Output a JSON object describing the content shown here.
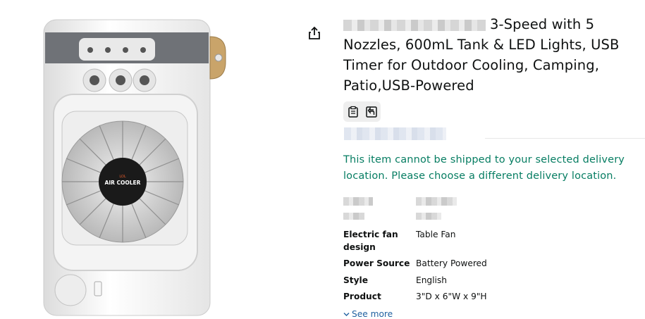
{
  "product": {
    "title_visible": "3-Speed with 5 Nozzles, 600mL Tank & LED Lights, USB Timer for Outdoor Cooling, Camping, Patio,USB-Powered",
    "image_badge_small": "LOL",
    "image_badge_text": "AIR COOLER"
  },
  "delivery": {
    "message": "This item cannot be shipped to your selected delivery location. Please choose a different delivery location."
  },
  "specs": [
    {
      "key": "Electric fan design",
      "value": "Table Fan"
    },
    {
      "key": "Power Source",
      "value": "Battery Powered"
    },
    {
      "key": "Style",
      "value": "English"
    },
    {
      "key": "Product",
      "value": "3\"D x 6\"W x 9\"H"
    }
  ],
  "see_more": "See more",
  "colors": {
    "delivery_green": "#067d62",
    "link_blue": "#2162a1"
  },
  "icons": [
    "share-icon",
    "clipboard-icon",
    "feedback-icon",
    "chevron-down-icon"
  ]
}
